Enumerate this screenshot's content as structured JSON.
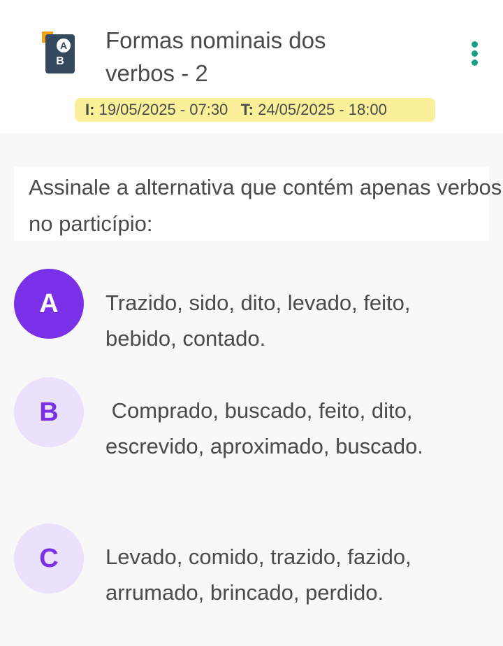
{
  "header": {
    "title": "Formas nominais dos verbos - 2",
    "icon_letters": {
      "top": "A",
      "bottom": "B"
    },
    "dates": {
      "start_label": "I:",
      "start_value": "19/05/2025 - 07:30",
      "end_label": "T:",
      "end_value": "24/05/2025 - 18:00"
    }
  },
  "question": {
    "text": "Assinale a alternativa que contém apenas verbos no particípio:"
  },
  "options": [
    {
      "letter": "A",
      "text": "Trazido, sido, dito, levado, feito, bebido, contado.",
      "selected": true
    },
    {
      "letter": "B",
      "text": " Comprado, buscado, feito, dito, escrevido, aproximado, buscado.",
      "selected": false
    },
    {
      "letter": "C",
      "text": "Levado, comido, trazido, fazido, arrumado, brincado, perdido.",
      "selected": false
    }
  ],
  "colors": {
    "accent": "#7a30e6",
    "option_bg": "#ece1fc",
    "menu_dots": "#17a085",
    "date_bg": "#fbf09a",
    "icon_card": "#34495e",
    "icon_square": "#f4a015"
  }
}
